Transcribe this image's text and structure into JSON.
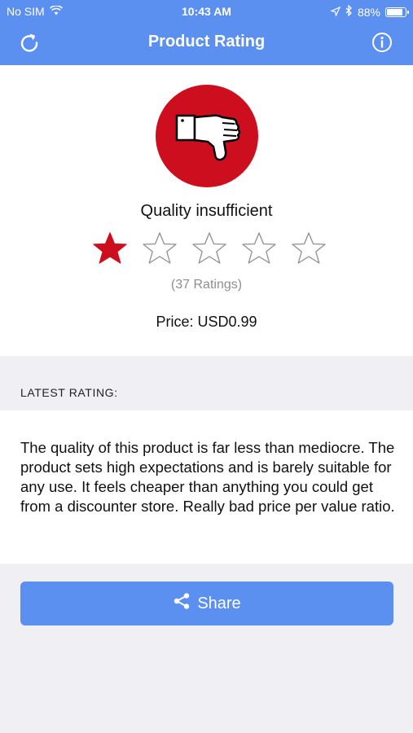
{
  "status_bar": {
    "carrier": "No SIM",
    "time": "10:43 AM",
    "battery": "88%",
    "battery_level": 0.88,
    "icons": [
      "wifi-icon",
      "location-arrow-icon",
      "bluetooth-icon",
      "battery-icon"
    ]
  },
  "nav": {
    "title": "Product Rating",
    "left_icon": "refresh-icon",
    "right_icon": "info-icon"
  },
  "product": {
    "icon": "thumbs-down-icon",
    "quality_label": "Quality insufficient",
    "rating": 1,
    "rating_max": 5,
    "ratings_count": "(37 Ratings)",
    "price": "Price: USD0.99"
  },
  "latest": {
    "section_label": "LATEST RATING:",
    "review": "The quality of this product is far less than mediocre. The product sets high expectations and is barely suitable for any use. It feels cheaper than anything you could get from a discounter store. Really bad price per value ratio."
  },
  "share": {
    "label": "Share",
    "icon": "share-icon"
  },
  "colors": {
    "nav_blue": "#5b8ff0",
    "thumb_red": "#cc0e1e",
    "star_red": "#cc0e1e",
    "background": "#efeff4"
  }
}
